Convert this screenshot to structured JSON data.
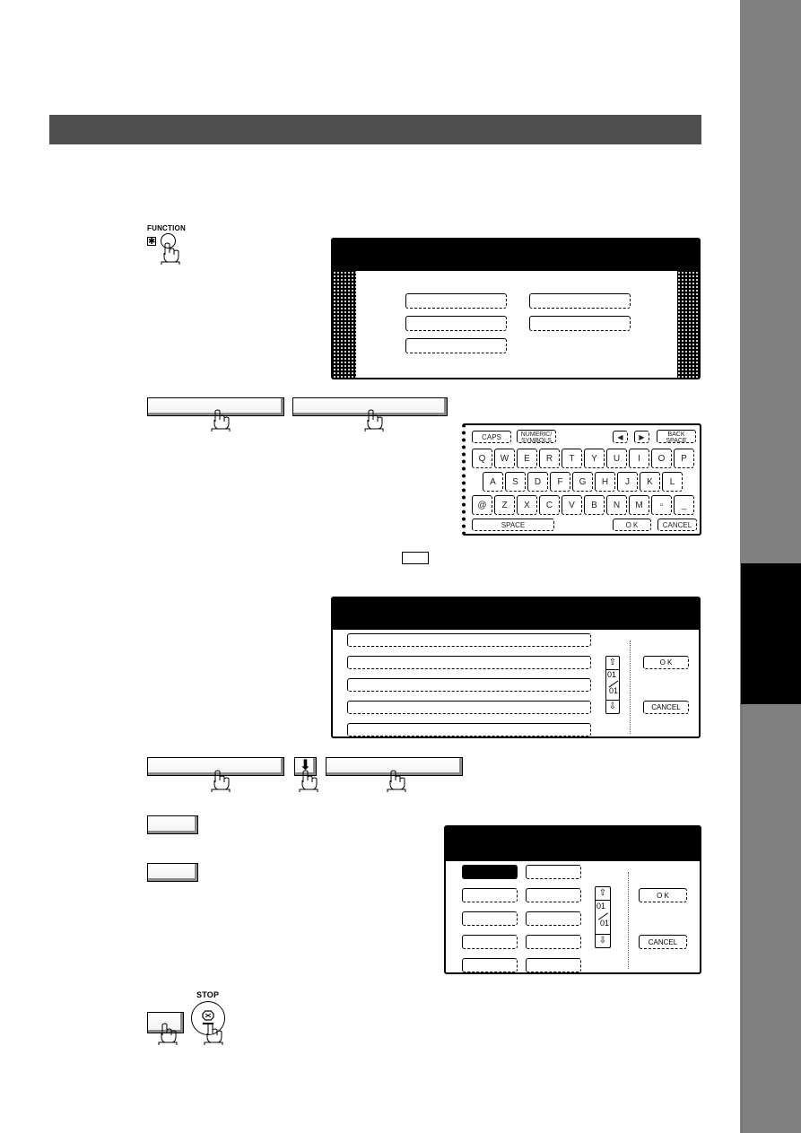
{
  "page": {
    "section_header": "",
    "side_tab": {
      "strip_color": "#808080",
      "tab_color": "#000000"
    }
  },
  "step1": {
    "function_key_label": "FUNCTION",
    "star_symbol": "✱",
    "screen": {
      "title": "",
      "buttons": [
        "",
        "",
        "",
        "",
        ""
      ]
    }
  },
  "step2": {
    "softkeys": [
      "",
      ""
    ],
    "keyboard": {
      "top_row": {
        "caps": "CAPS",
        "numeric_symbols": "NUMERIC/ SYMBOLS",
        "left_arrow": "◀",
        "right_arrow": "▶",
        "back_space": "BACK SPACE"
      },
      "rows": [
        [
          "Q",
          "W",
          "E",
          "R",
          "T",
          "Y",
          "U",
          "I",
          "O",
          "P"
        ],
        [
          "A",
          "S",
          "D",
          "F",
          "G",
          "H",
          "J",
          "K",
          "L"
        ],
        [
          "@",
          "Z",
          "X",
          "C",
          "V",
          "B",
          "N",
          "M",
          "▫",
          "_"
        ]
      ],
      "space": "SPACE",
      "ok": "O K",
      "cancel": "CANCEL"
    },
    "inline_box_label": ""
  },
  "step3": {
    "screen": {
      "title": "",
      "list_items": [
        "",
        "",
        "",
        "",
        ""
      ],
      "page_current": "01",
      "page_total": "01",
      "ok": "O K",
      "cancel": "CANCEL"
    }
  },
  "step4": {
    "softkey_left": "",
    "down_arrow": "⬇",
    "softkey_right": ""
  },
  "step5": {
    "softkey_a": "",
    "softkey_b": "",
    "screen": {
      "title": "",
      "grid_items": [
        "",
        "",
        "",
        "",
        "",
        "",
        "",
        "",
        "",
        ""
      ],
      "page_current": "01",
      "page_total": "01",
      "ok": "O K",
      "cancel": "CANCEL"
    }
  },
  "step6": {
    "softkey": "",
    "stop_key_label": "STOP"
  }
}
